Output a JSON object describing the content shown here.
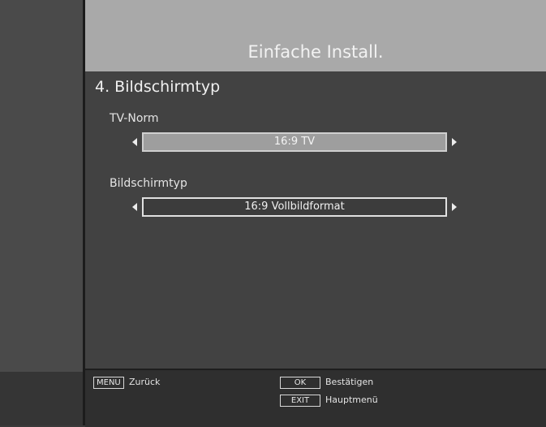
{
  "header": {
    "title": "Einfache Install."
  },
  "section": {
    "title": "4. Bildschirmtyp"
  },
  "settings": [
    {
      "label": "TV-Norm",
      "value": "16:9 TV"
    },
    {
      "label": "Bildschirmtyp",
      "value": "16:9 Vollbildformat"
    }
  ],
  "footer": {
    "menu_key": "MENU",
    "menu_text": "Zurück",
    "ok_key": "OK",
    "ok_text": "Bestätigen",
    "exit_key": "EXIT",
    "exit_text": "Hauptmenü"
  }
}
